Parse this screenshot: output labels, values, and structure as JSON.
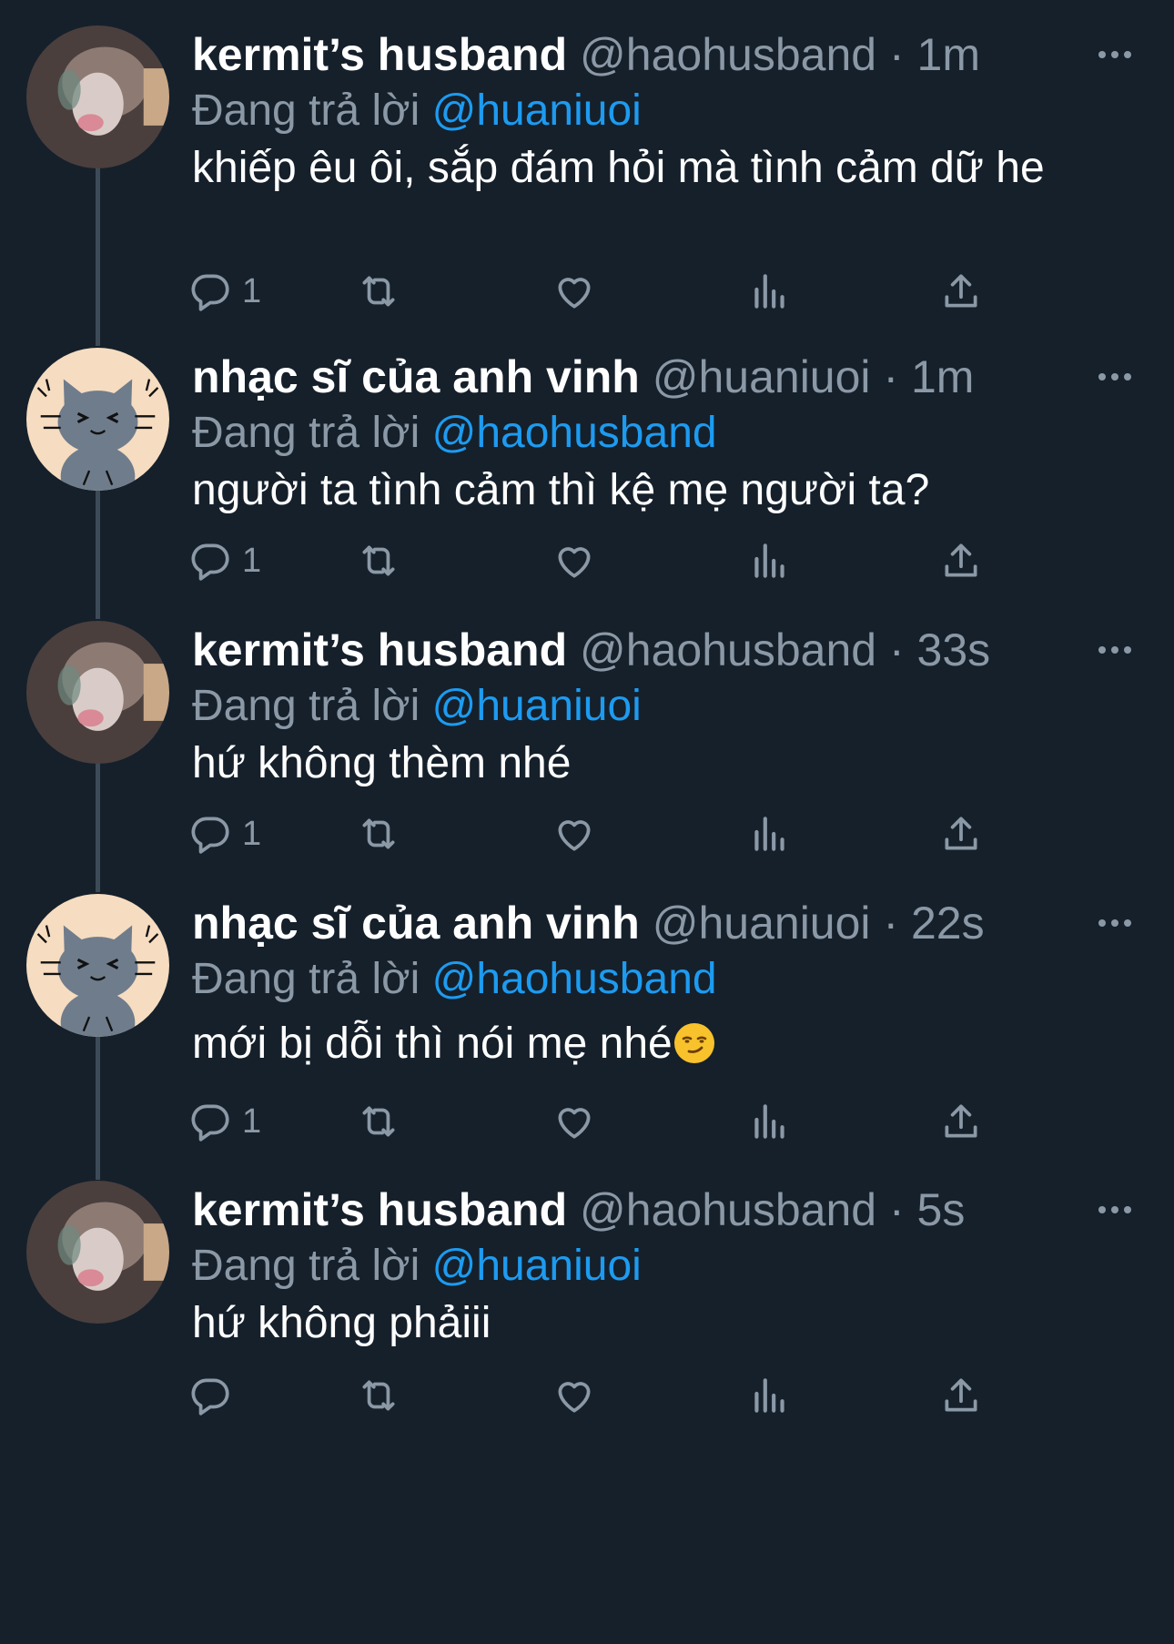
{
  "tweets": [
    {
      "name": "kermit’s husband",
      "handle": "@haohusband",
      "dot": "·",
      "time": "1m",
      "reply_prefix": "Đang trả lời",
      "reply_to": "@huaniuoi",
      "text": "khiếp êu ôi, sắp đám hỏi mà tình cảm dữ he",
      "reply_count": "1"
    },
    {
      "name": "nhạc sĩ của anh vinh",
      "handle": "@huaniuoi",
      "dot": "·",
      "time": "1m",
      "reply_prefix": "Đang trả lời",
      "reply_to": "@haohusband",
      "text": "người ta tình cảm thì kệ mẹ người ta?",
      "reply_count": "1"
    },
    {
      "name": "kermit’s husband",
      "handle": "@haohusband",
      "dot": "·",
      "time": "33s",
      "reply_prefix": "Đang trả lời",
      "reply_to": "@huaniuoi",
      "text": "hứ không thèm nhé",
      "reply_count": "1"
    },
    {
      "name": "nhạc sĩ của anh vinh",
      "handle": "@huaniuoi",
      "dot": "·",
      "time": "22s",
      "reply_prefix": "Đang trả lời",
      "reply_to": "@haohusband",
      "text": "mới bị dỗi thì nói mẹ nhé",
      "text_emoji": "smirking-face-emoji",
      "reply_count": "1"
    },
    {
      "name": "kermit’s husband",
      "handle": "@haohusband",
      "dot": "·",
      "time": "5s",
      "reply_prefix": "Đang trả lời",
      "reply_to": "@huaniuoi",
      "text": "hứ không phảiii",
      "reply_count": ""
    }
  ],
  "icons": {
    "reply": "reply-icon",
    "retweet": "retweet-icon",
    "like": "heart-icon",
    "views": "views-icon",
    "share": "share-icon",
    "more": "more-icon"
  },
  "colors": {
    "background": "#15202b",
    "accent": "#1d9bf0",
    "secondary_text": "#8b98a5",
    "thread_line": "#3d4a57"
  }
}
